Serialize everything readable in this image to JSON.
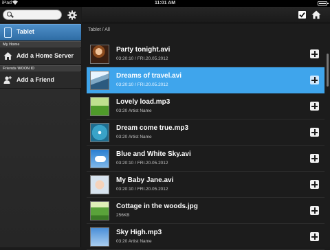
{
  "status_bar": {
    "carrier": "iPad",
    "time": "11:01 AM"
  },
  "sidebar": {
    "search": {
      "placeholder": ""
    },
    "current": {
      "label": "Tablet"
    },
    "sections": [
      {
        "header": "My Home",
        "item": "Add a Home Server"
      },
      {
        "header": "Friends WOON ID",
        "item": "Add a Friend"
      }
    ]
  },
  "main": {
    "breadcrumb": "Tablet / All",
    "items": [
      {
        "name": "Party tonight.avi",
        "meta": "03:20:10 / FRI.20.05.2012",
        "thumb": "party-thumbnail",
        "selected": false
      },
      {
        "name": "Dreams of travel.avi",
        "meta": "03:20:10 / FRI.20.05.2012",
        "thumb": "travel-thumbnail",
        "selected": true
      },
      {
        "name": "Lovely load.mp3",
        "meta": "03:20  Artist Name",
        "thumb": "field-thumbnail",
        "selected": false
      },
      {
        "name": "Dream come true.mp3",
        "meta": "03:20  Artist Name",
        "thumb": "flower-thumbnail",
        "selected": false
      },
      {
        "name": "Blue and White Sky.avi",
        "meta": "03:20:10 / FRI.20.05.2012",
        "thumb": "sky-thumbnail",
        "selected": false
      },
      {
        "name": "My Baby Jane.avi",
        "meta": "03:20:10 / FRI.20.05.2012",
        "thumb": "baby-thumbnail",
        "selected": false
      },
      {
        "name": "Cottage in the woods.jpg",
        "meta": "256KB",
        "thumb": "cottage-thumbnail",
        "selected": false
      },
      {
        "name": "Sky High.mp3",
        "meta": "03:20  Artist Name",
        "thumb": "clouds-thumbnail",
        "selected": false
      }
    ]
  },
  "colors": {
    "accent": "#3fa5ec",
    "sidebar_selected": "#3f7fb9",
    "background": "#1c1c1c"
  },
  "icons": [
    "search-icon",
    "gear-icon",
    "tablet-icon",
    "home-server-icon",
    "add-friend-icon",
    "select-all-icon",
    "home-icon",
    "add-icon",
    "wifi-icon",
    "battery-icon"
  ]
}
